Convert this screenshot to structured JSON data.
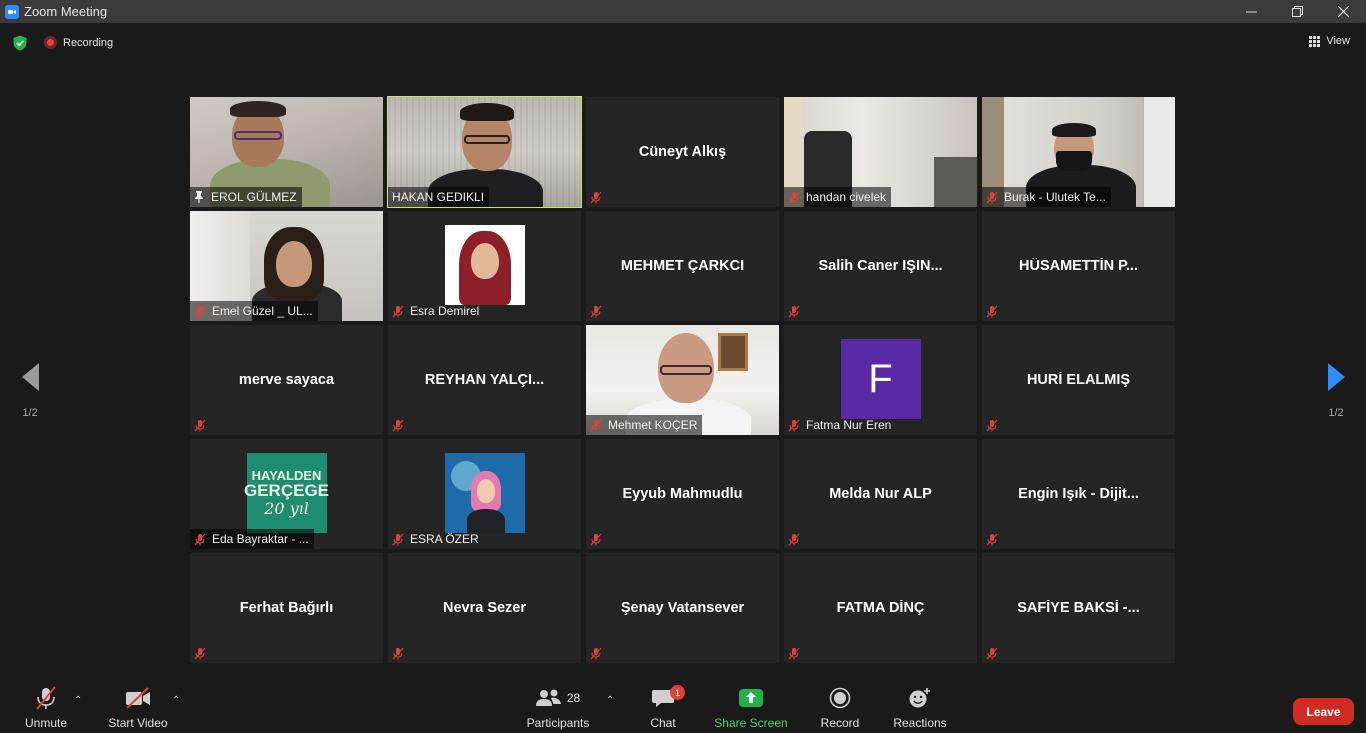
{
  "window": {
    "title": "Zoom Meeting"
  },
  "topbar": {
    "recording_label": "Recording",
    "view_label": "View"
  },
  "pagination": {
    "left_label": "1/2",
    "right_label": "1/2"
  },
  "participants": [
    {
      "name": "EROL GÜLMEZ",
      "video": true,
      "pinned": true
    },
    {
      "name": "HAKAN GEDIKLI",
      "video": true,
      "active_speaker": true
    },
    {
      "name": "Cüneyt Alkış",
      "video": false
    },
    {
      "name": "handan civelek",
      "video": true
    },
    {
      "name": "Burak - Ulutek Te...",
      "video": true
    },
    {
      "name": "Emel Güzel _ UL...",
      "video": true
    },
    {
      "name": "Esra Demirel",
      "video": false,
      "photo": true
    },
    {
      "name": "MEHMET ÇARKCI",
      "video": false
    },
    {
      "name": "Salih Caner IŞIN...",
      "video": false
    },
    {
      "name": "HÜSAMETTİN P...",
      "video": false
    },
    {
      "name": "merve sayaca",
      "video": false
    },
    {
      "name": "REYHAN YALÇI...",
      "video": false
    },
    {
      "name": "Mehmet KOÇER",
      "video": true
    },
    {
      "name": "Fatma Nur Eren",
      "video": false,
      "avatar_letter": "F"
    },
    {
      "name": "HURİ ELALMIŞ",
      "video": false
    },
    {
      "name": "Eda Bayraktar - ...",
      "video": false,
      "photo": true,
      "photo_text": [
        "HAYALDEN",
        "GERÇEGE",
        "20 yıl"
      ]
    },
    {
      "name": "ESRA ÖZER",
      "video": false,
      "photo": true
    },
    {
      "name": "Eyyub Mahmudlu",
      "video": false
    },
    {
      "name": "Melda Nur ALP",
      "video": false
    },
    {
      "name": "Engin Işık - Dijit...",
      "video": false
    },
    {
      "name": "Ferhat Bağırlı",
      "video": false
    },
    {
      "name": "Nevra Sezer",
      "video": false
    },
    {
      "name": "Şenay Vatansever",
      "video": false
    },
    {
      "name": "FATMA DİNÇ",
      "video": false
    },
    {
      "name": "SAFİYE BAKSİ -...",
      "video": false
    }
  ],
  "toolbar": {
    "unmute": "Unmute",
    "start_video": "Start Video",
    "participants": "Participants",
    "participants_count": "28",
    "chat": "Chat",
    "chat_badge": "1",
    "share_screen": "Share Screen",
    "record": "Record",
    "reactions": "Reactions",
    "leave": "Leave"
  },
  "colors": {
    "accent": "#2d8cff",
    "active_speaker": "#c8e85a",
    "leave": "#cf2c24",
    "share": "#23b14d",
    "mic_off": "#e0403a"
  }
}
